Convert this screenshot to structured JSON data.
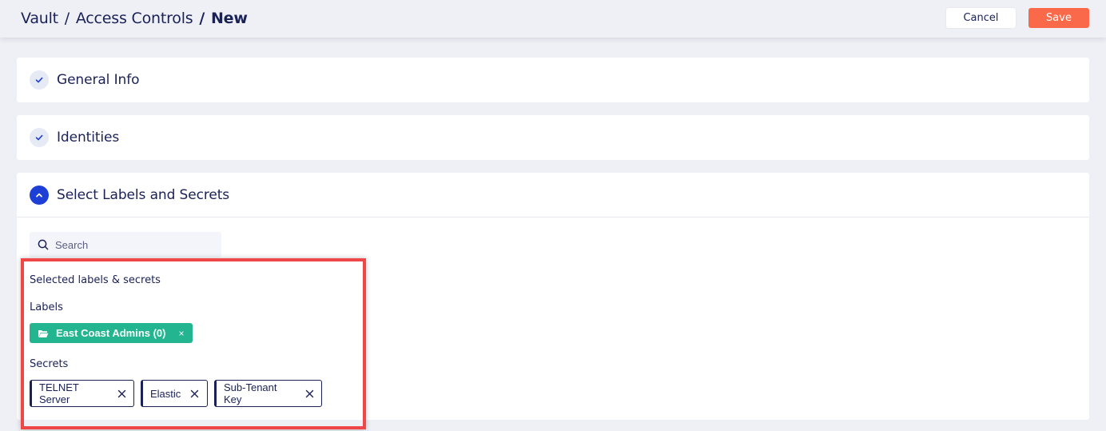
{
  "header": {
    "breadcrumb": {
      "part1": "Vault",
      "sep1": "/",
      "part2": "Access Controls",
      "sep2": "/",
      "current": "New"
    },
    "cancel_label": "Cancel",
    "save_label": "Save"
  },
  "sections": {
    "general": {
      "title": "General Info",
      "icon": "check-icon"
    },
    "identities": {
      "title": "Identities",
      "icon": "check-icon"
    },
    "select": {
      "title": "Select Labels and Secrets",
      "icon": "chevron-up-icon"
    }
  },
  "search": {
    "placeholder": "Search",
    "value": ""
  },
  "selected": {
    "heading": "Selected labels & secrets",
    "labels_heading": "Labels",
    "labels": [
      {
        "name": "East Coast Admins (0)",
        "remove": "×"
      }
    ],
    "secrets_heading": "Secrets",
    "secrets": [
      {
        "name": "TELNET Server"
      },
      {
        "name": "Elastic"
      },
      {
        "name": "Sub-Tenant Key"
      }
    ]
  },
  "colors": {
    "accent": "#1d3fd6",
    "save": "#fa6a4a",
    "label_chip": "#22b58f",
    "highlight": "#ef4747",
    "text": "#1a2157"
  }
}
